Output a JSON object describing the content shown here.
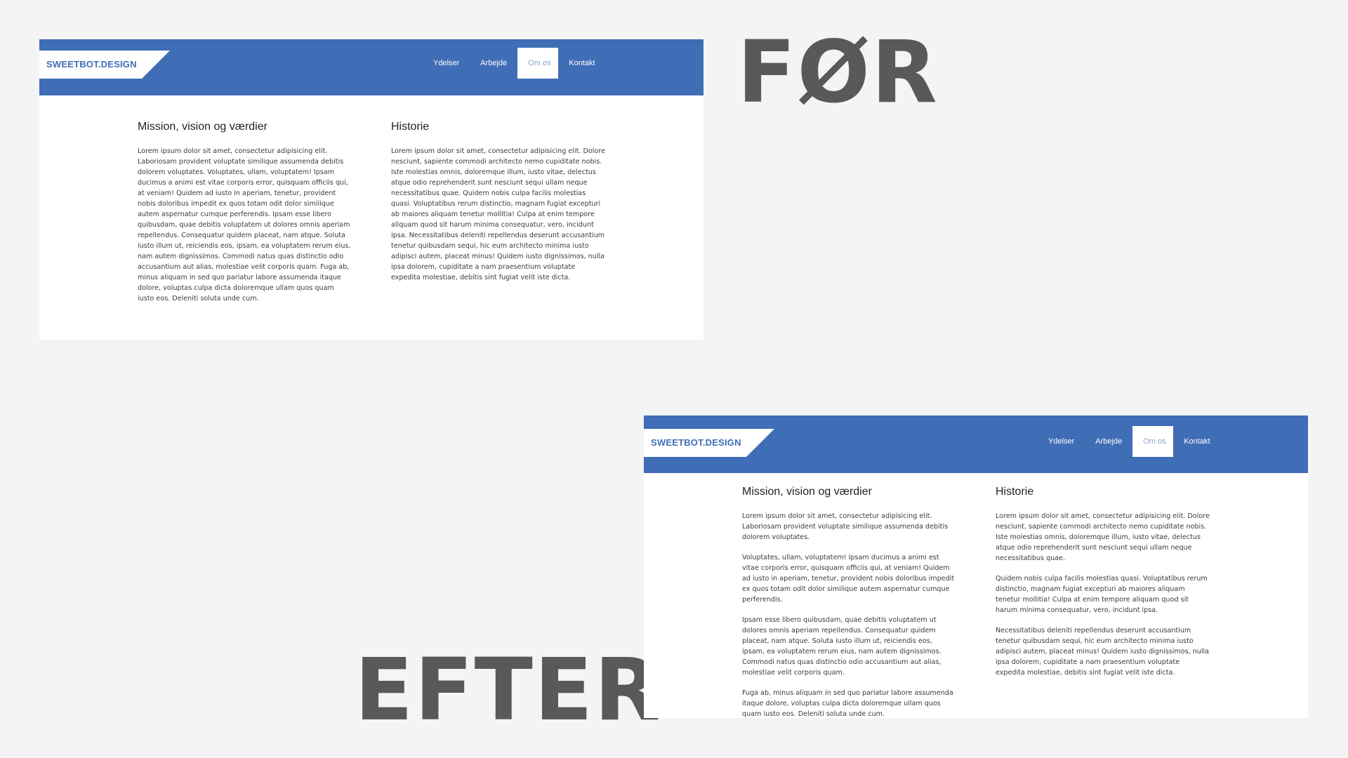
{
  "captions": {
    "before": "FØR",
    "after": "EFTER"
  },
  "site": {
    "logo": "SWEETBOT.DESIGN",
    "nav": [
      "Ydelser",
      "Arbejde",
      "Om os",
      "Kontakt"
    ],
    "active_nav": "Om os",
    "colors": {
      "header": "#3f6db6",
      "background": "#f4f4f4",
      "caption": "#595959"
    }
  },
  "before": {
    "mission_heading": "Mission, vision og værdier",
    "mission_text": "Lorem ipsum dolor sit amet, consectetur adipisicing elit. Laboriosam provident voluptate similique assumenda debitis dolorem voluptates. Voluptates, ullam, voluptatem! Ipsam ducimus a animi est vitae corporis error, quisquam officiis qui, at veniam! Quidem ad iusto in aperiam, tenetur, provident nobis doloribus impedit ex quos totam odit dolor similique autem aspernatur cumque perferendis. Ipsam esse libero quibusdam, quae debitis voluptatem ut dolores omnis aperiam repellendus. Consequatur quidem placeat, nam atque. Soluta iusto illum ut, reiciendis eos, ipsam, ea voluptatem rerum eius, nam autem dignissimos. Commodi natus quas distinctio odio accusantium aut alias, molestiae velit corporis quam. Fuga ab, minus aliquam in sed quo pariatur labore assumenda itaque dolore, voluptas culpa dicta doloremque ullam quos quam iusto eos. Deleniti soluta unde cum.",
    "history_heading": "Historie",
    "history_text": "Lorem ipsum dolor sit amet, consectetur adipisicing elit. Dolore nesciunt, sapiente commodi architecto nemo cupiditate nobis. Iste molestias omnis, doloremque illum, iusto vitae, delectus atque odio reprehenderit sunt nesciunt sequi ullam neque necessitatibus quae. Quidem nobis culpa facilis molestias quasi. Voluptatibus rerum distinctio, magnam fugiat excepturi ab maiores aliquam tenetur mollitia! Culpa at enim tempore aliquam quod sit harum minima consequatur, vero, incidunt ipsa. Necessitatibus deleniti repellendus deserunt accusantium tenetur quibusdam sequi, hic eum architecto minima iusto adipisci autem, placeat minus! Quidem iusto dignissimos, nulla ipsa dolorem, cupiditate a nam praesentium voluptate expedita molestiae, debitis sint fugiat velit iste dicta."
  },
  "after": {
    "mission_heading": "Mission, vision og værdier",
    "mission_paragraphs": [
      "Lorem ipsum dolor sit amet, consectetur adipisicing elit. Laboriosam provident voluptate similique assumenda debitis dolorem voluptates.",
      "Voluptates, ullam, voluptatem! Ipsam ducimus a animi est vitae corporis error, quisquam officiis qui, at veniam! Quidem ad iusto in aperiam, tenetur, provident nobis doloribus impedit ex quos totam odit dolor similique autem aspernatur cumque perferendis.",
      "Ipsam esse libero quibusdam, quae debitis voluptatem ut dolores omnis aperiam repellendus. Consequatur quidem placeat, nam atque. Soluta iusto illum ut, reiciendis eos, ipsam, ea voluptatem rerum eius, nam autem dignissimos. Commodi natus quas distinctio odio accusantium aut alias, molestiae velit corporis quam.",
      "Fuga ab, minus aliquam in sed quo pariatur labore assumenda itaque dolore, voluptas culpa dicta doloremque ullam quos quam iusto eos. Deleniti soluta unde cum."
    ],
    "history_heading": "Historie",
    "history_paragraphs": [
      "Lorem ipsum dolor sit amet, consectetur adipisicing elit. Dolore nesciunt, sapiente commodi architecto nemo cupiditate nobis. Iste molestias omnis, doloremque illum, iusto vitae, delectus atque odio reprehenderit sunt nesciunt sequi ullam neque necessitatibus quae.",
      "Quidem nobis culpa facilis molestias quasi. Voluptatibus rerum distinctio, magnam fugiat excepturi ab maiores aliquam tenetur mollitia! Culpa at enim tempore aliquam quod sit harum minima consequatur, vero, incidunt ipsa.",
      "Necessitatibus deleniti repellendus deserunt accusantium tenetur quibusdam sequi, hic eum architecto minima iusto adipisci autem, placeat minus! Quidem iusto dignissimos, nulla ipsa dolorem, cupiditate a nam praesentium voluptate expedita molestiae, debitis sint fugiat velit iste dicta."
    ]
  }
}
